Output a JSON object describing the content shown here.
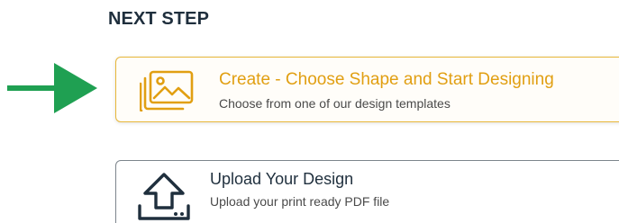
{
  "next_step": {
    "heading": "NEXT STEP"
  },
  "options": [
    {
      "title": "Create - Choose Shape and Start Designing",
      "subtitle": "Choose from one of our design templates",
      "icon": "image-gallery-icon",
      "selected": true
    },
    {
      "title": "Upload Your Design",
      "subtitle": "Upload your print ready PDF file",
      "icon": "upload-icon",
      "selected": false
    }
  ],
  "colors": {
    "accent": "#e19f12",
    "arrow": "#1fa052",
    "heading": "#1f2f3d",
    "border": "#7d858c"
  },
  "arrow_icon": "right-arrow-icon"
}
